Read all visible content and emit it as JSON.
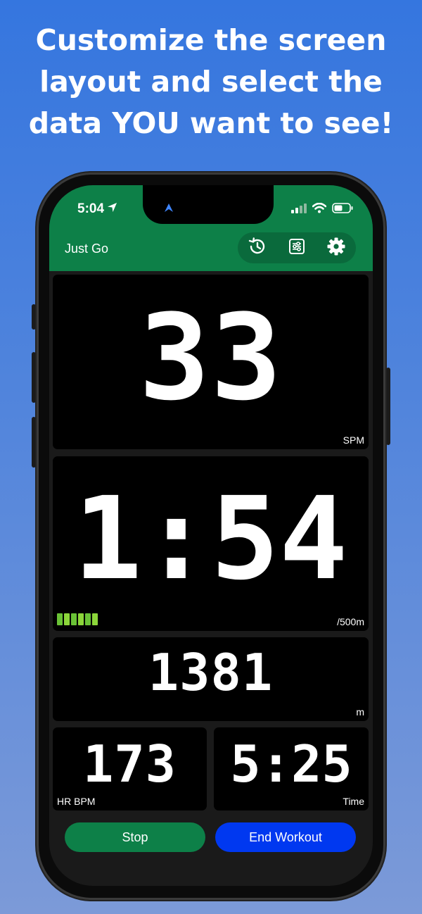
{
  "headline": {
    "line1": "Customize the screen",
    "line2": "layout and select the",
    "line3": "data YOU want to see!"
  },
  "status_bar": {
    "time": "5:04",
    "location_icon": "location-arrow-icon",
    "signal_icon": "cellular-signal-icon",
    "wifi_icon": "wifi-icon",
    "battery_icon": "battery-icon"
  },
  "app_header": {
    "title": "Just Go",
    "toolbar": [
      "history-icon",
      "sliders-icon",
      "gear-icon"
    ]
  },
  "tiles": {
    "stroke_rate": {
      "value": "33",
      "unit": "SPM"
    },
    "pace": {
      "value": "1:54",
      "unit": "/500m",
      "intensity_bars": 6
    },
    "distance": {
      "value": "1381",
      "unit": "m"
    },
    "heart_rate": {
      "value": "173",
      "unit": "HR BPM"
    },
    "time": {
      "value": "5:25",
      "unit": "Time"
    }
  },
  "actions": {
    "stop_label": "Stop",
    "end_label": "End Workout"
  },
  "colors": {
    "header_green": "#0d8048",
    "stop_green": "#0d8048",
    "end_blue": "#0038f0",
    "bar_green": "#6ac236"
  }
}
